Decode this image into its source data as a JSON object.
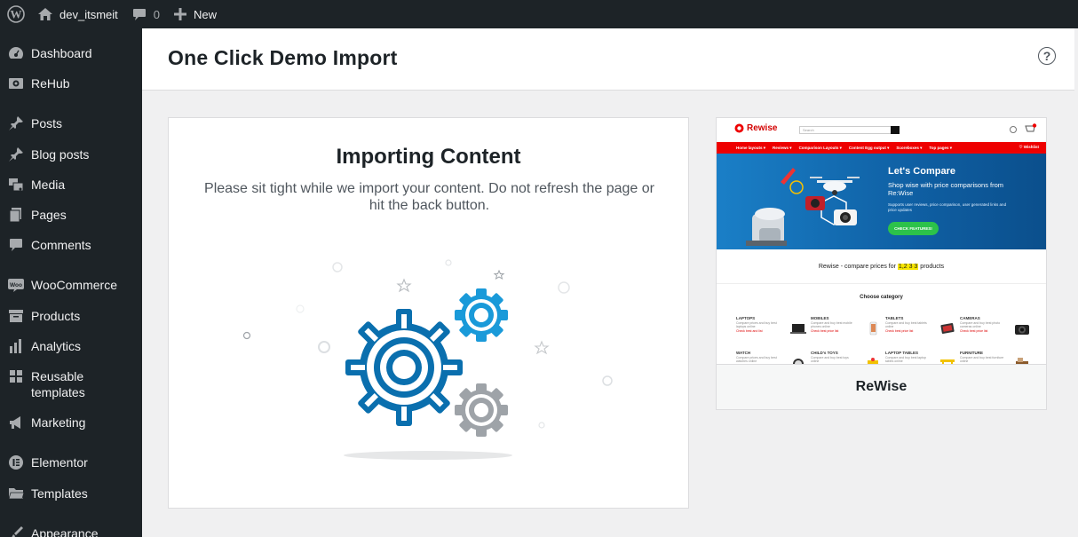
{
  "admin_bar": {
    "site_name": "dev_itsmeit",
    "comments_count": "0",
    "new_label": "New"
  },
  "sidebar": {
    "items": [
      {
        "label": "Dashboard",
        "icon": "dashboard-icon"
      },
      {
        "label": "ReHub",
        "icon": "rehub-icon"
      },
      {
        "label": "Posts",
        "icon": "pin-icon"
      },
      {
        "label": "Blog posts",
        "icon": "pin-icon"
      },
      {
        "label": "Media",
        "icon": "media-icon"
      },
      {
        "label": "Pages",
        "icon": "pages-icon"
      },
      {
        "label": "Comments",
        "icon": "comment-icon"
      },
      {
        "label": "WooCommerce",
        "icon": "woo-icon"
      },
      {
        "label": "Products",
        "icon": "archive-icon"
      },
      {
        "label": "Analytics",
        "icon": "chart-icon"
      },
      {
        "label": "Reusable templates",
        "icon": "grid-icon"
      },
      {
        "label": "Marketing",
        "icon": "megaphone-icon"
      },
      {
        "label": "Elementor",
        "icon": "elementor-icon"
      },
      {
        "label": "Templates",
        "icon": "folder-icon"
      },
      {
        "label": "Appearance",
        "icon": "brush-icon"
      }
    ]
  },
  "header": {
    "title": "One Click Demo Import",
    "help_symbol": "?"
  },
  "import_panel": {
    "title": "Importing Content",
    "description": "Please sit tight while we import your content. Do not refresh the page or hit the back button."
  },
  "demo": {
    "name": "ReWise",
    "preview": {
      "logo": "Rewise",
      "search_placeholder": "Search",
      "nav": [
        "Home layouts ▾",
        "Reviews ▾",
        "Comparison Layouts ▾",
        "Content Egg output ▾",
        "Scoreboxes ▾",
        "Top pages ▾"
      ],
      "wishlist": "♡ Wishlist",
      "hero_title": "Let's Compare",
      "hero_subtitle": "Shop wise with price comparisons from Re:Wise",
      "hero_small": "Supports user reviews, price comparison, user generated links and price updates",
      "hero_button": "CHECK FEATURES!",
      "compare_prefix": "Rewise - compare prices for",
      "compare_number": "1,2 3 3",
      "compare_suffix": "products",
      "choose_title": "Choose category",
      "categories": [
        {
          "name": "LAPTOPS",
          "desc": "Compare prices and buy best laptops online",
          "link": "Check best and list"
        },
        {
          "name": "MOBILES",
          "desc": "Compare and buy best mobile phones online",
          "link": "Check best price list"
        },
        {
          "name": "TABLETS",
          "desc": "Compare and buy best tablets online",
          "link": "Check best price list"
        },
        {
          "name": "CAMERAS",
          "desc": "Compare and buy best photo cameras online",
          "link": "Check best price list"
        },
        {
          "name": "WATCH",
          "desc": "Compare prices and buy best watches online",
          "link": "Check best and list"
        },
        {
          "name": "CHILD's TOYS",
          "desc": "Compare and buy best toys online",
          "link": "Check best price list"
        },
        {
          "name": "LAPTOP TABLES",
          "desc": "Compare and buy best laptop tables online",
          "link": "Check best price list"
        },
        {
          "name": "FURNITURE",
          "desc": "Compare and buy best furniture online",
          "link": "Check best price list"
        }
      ]
    }
  },
  "colors": {
    "admin_dark": "#1d2327",
    "gear_blue": "#0073aa",
    "gear_light_blue": "#1a9ad9",
    "gear_gray": "#9ea3a8",
    "rewise_red": "#e00000"
  }
}
